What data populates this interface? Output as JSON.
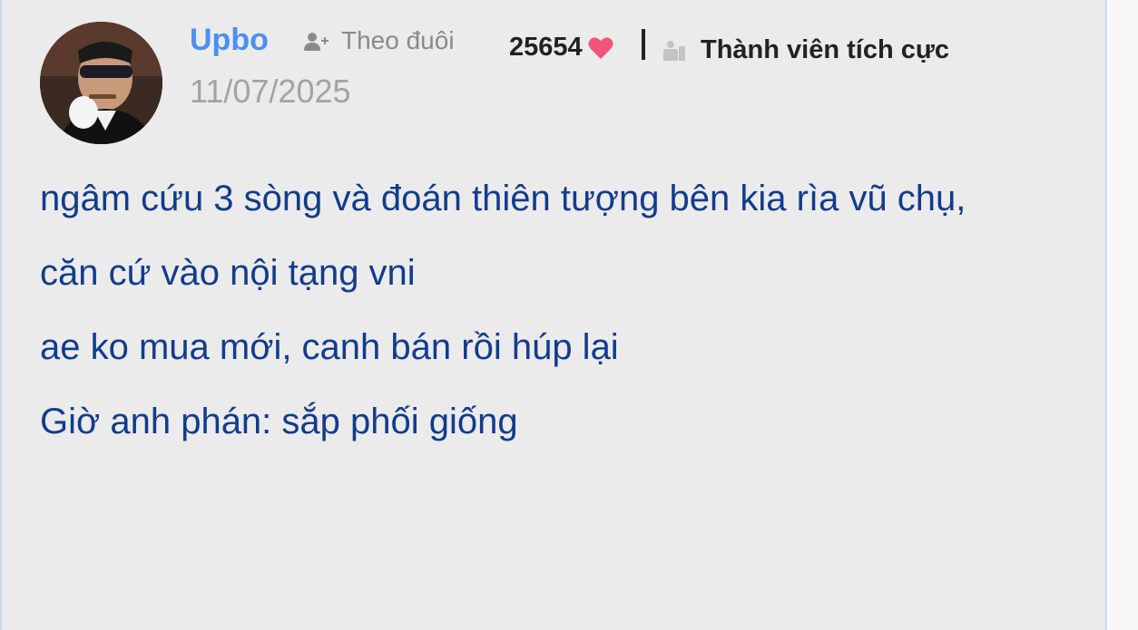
{
  "author": {
    "username": "Upbo",
    "follow_label": "Theo đuôi",
    "date": "11/07/2025"
  },
  "stats": {
    "likes": "25654",
    "member_rank": "Thành viên tích cực"
  },
  "post": {
    "paragraphs": [
      "ngâm cứu 3 sòng và đoán thiên tượng bên kia rìa vũ chụ,",
      "căn cứ vào nội tạng vni",
      "ae ko mua mới, canh bán rồi húp lại",
      "Giờ anh phán: sắp phối giống"
    ]
  },
  "icons": {
    "follow": "user-plus-icon",
    "likes": "heart-icon",
    "rank": "member-badge-icon"
  },
  "colors": {
    "username": "#4a90f0",
    "body_text": "#123c8c",
    "muted": "#8a8a8a",
    "heart": "#f2557a",
    "card_bg": "#ebebeb"
  }
}
